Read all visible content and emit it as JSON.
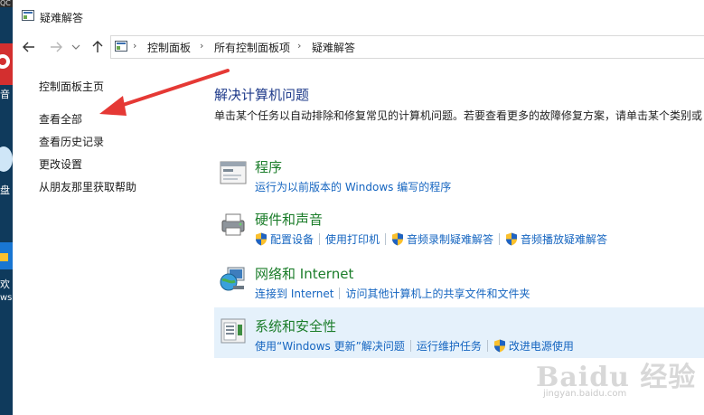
{
  "desktop": {
    "top_text": "QC",
    "labels": [
      "音",
      "盘",
      "欢",
      "ws"
    ]
  },
  "window": {
    "title": "疑难解答"
  },
  "address": {
    "crumbs": [
      "控制面板",
      "所有控制面板项",
      "疑难解答"
    ]
  },
  "sidebar": {
    "items": [
      {
        "label": "控制面板主页"
      },
      {
        "label": "查看全部"
      },
      {
        "label": "查看历史记录"
      },
      {
        "label": "更改设置"
      },
      {
        "label": "从朋友那里获取帮助"
      }
    ]
  },
  "main": {
    "title": "解决计算机问题",
    "description": "单击某个任务以自动排除和修复常见的计算机问题。若要查看更多的故障修复方案，请单击某个类别或"
  },
  "categories": [
    {
      "title": "程序",
      "links": [
        {
          "label": "运行为以前版本的 Windows 编写的程序",
          "shield": false
        }
      ]
    },
    {
      "title": "硬件和声音",
      "links": [
        {
          "label": "配置设备",
          "shield": true
        },
        {
          "label": "使用打印机",
          "shield": false
        },
        {
          "label": "音频录制疑难解答",
          "shield": true
        },
        {
          "label": "音频播放疑难解答",
          "shield": true
        }
      ]
    },
    {
      "title": "网络和 Internet",
      "links": [
        {
          "label": "连接到 Internet",
          "shield": false
        },
        {
          "label": "访问其他计算机上的共享文件和文件夹",
          "shield": false
        }
      ]
    },
    {
      "title": "系统和安全性",
      "links": [
        {
          "label": "使用“Windows 更新”解决问题",
          "shield": false
        },
        {
          "label": "运行维护任务",
          "shield": false
        },
        {
          "label": "改进电源使用",
          "shield": true
        }
      ]
    }
  ],
  "watermark": {
    "main": "Baidu 经验",
    "sub": "jingyan.baidu.com"
  },
  "colors": {
    "link": "#1565c0",
    "category_title": "#1b7d2a",
    "main_title": "#1e3a8a",
    "highlight": "#e5f1fb",
    "arrow": "#e53935"
  }
}
